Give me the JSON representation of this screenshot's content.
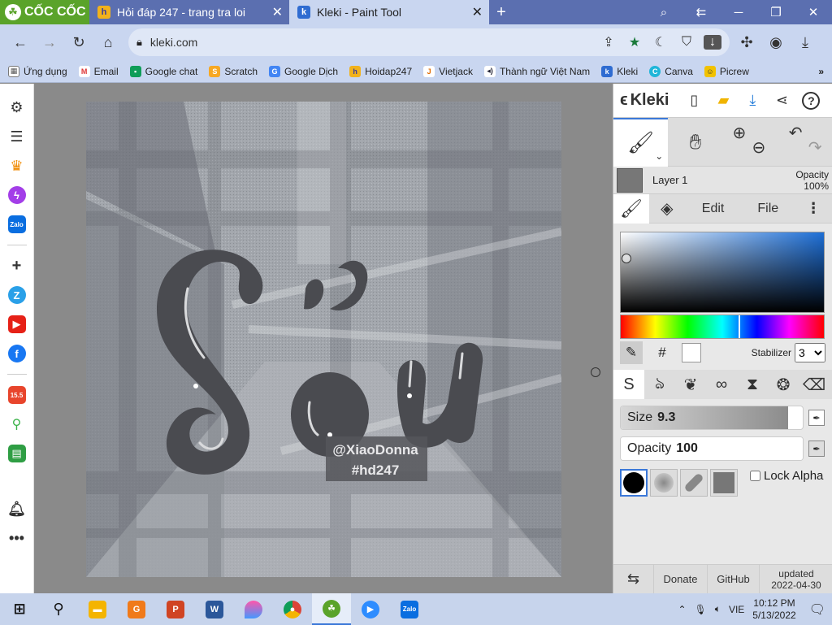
{
  "browser": {
    "brand": "CỐC CỐC",
    "tabs": [
      {
        "title": "Hỏi đáp 247 - trang tra loi",
        "active": false
      },
      {
        "title": "Kleki - Paint Tool",
        "active": true
      }
    ],
    "url": "kleki.com",
    "bookmarks": [
      "Ứng dụng",
      "Email",
      "Google chat",
      "Scratch",
      "Google Dịch",
      "Hoidap247",
      "Vietjack",
      "Thành ngữ Việt Nam",
      "Kleki",
      "Canva",
      "Picrew"
    ]
  },
  "artwork": {
    "title_text": "Sầu",
    "watermark_line1": "@XiaoDonna",
    "watermark_line2": "#hd247"
  },
  "panel": {
    "logo": "Kleki",
    "layer": {
      "name": "Layer 1",
      "opacity_label": "Opacity",
      "opacity_value": "100%"
    },
    "tabs": {
      "edit": "Edit",
      "file": "File"
    },
    "hex_label": "#",
    "stabilizer_label": "Stabilizer",
    "stabilizer_value": "3",
    "size_label": "Size",
    "size_value": "9.3",
    "size_fraction": 0.92,
    "opacity_label": "Opacity",
    "opacity_value": "100",
    "opacity_fraction": 1.0,
    "lock_alpha": "Lock Alpha",
    "footer": {
      "donate": "Donate",
      "github": "GitHub",
      "updated": "updated",
      "date": "2022-04-30"
    }
  },
  "taskbar": {
    "lang": "VIE",
    "time": "10:12 PM",
    "date": "5/13/2022"
  },
  "colors": {
    "tab_bar": "#5b6fb0",
    "chrome": "#c9d6f0",
    "brand_green": "#5aa32a",
    "accent_blue": "#3b78d8"
  }
}
